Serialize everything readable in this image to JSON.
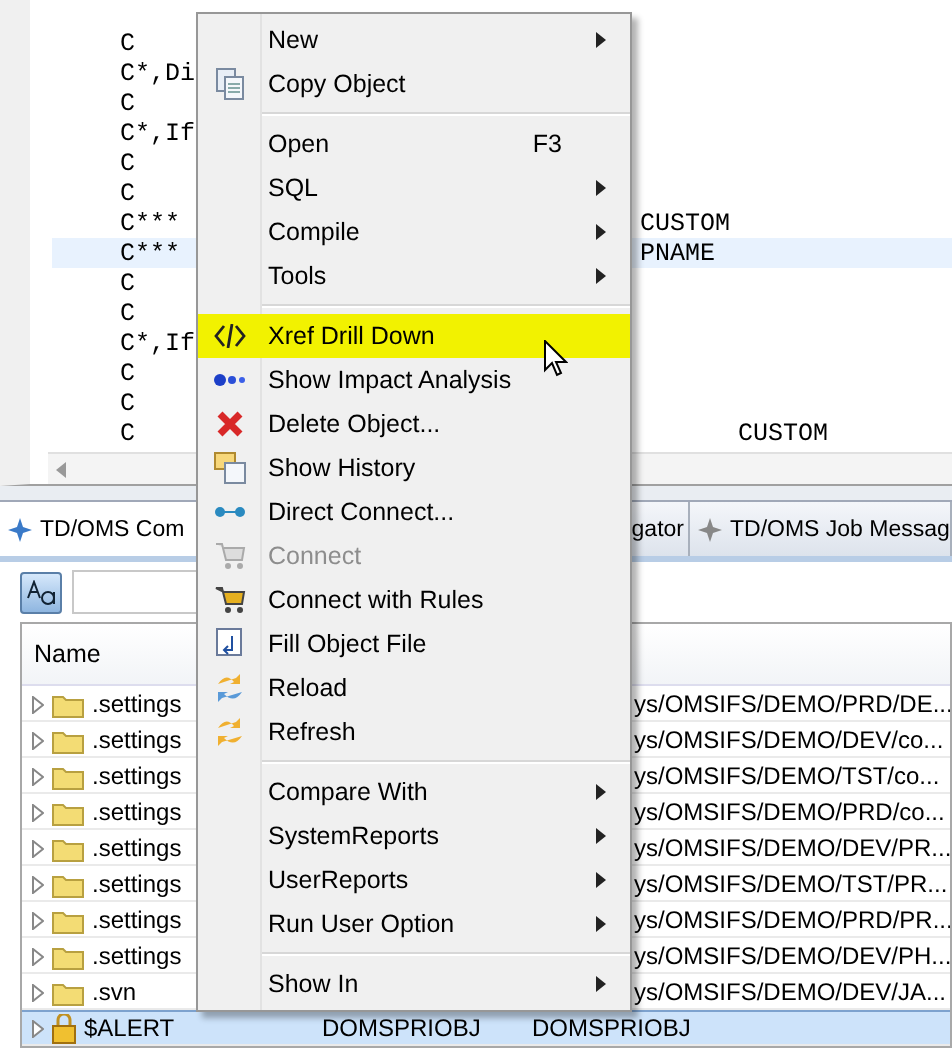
{
  "editor": {
    "lines": [
      {
        "code": "C",
        "selected": false
      },
      {
        "code": "C*,Di",
        "selected": false
      },
      {
        "code": "C",
        "selected": false
      },
      {
        "code": "C*,If",
        "selected": false
      },
      {
        "code": "C",
        "selected": false
      },
      {
        "code": "C",
        "selected": false
      },
      {
        "code": "C***",
        "column_2": "CUSTOM",
        "selected": false
      },
      {
        "code": "C***",
        "column_2": "PNAME",
        "selected": true
      },
      {
        "code": "C",
        "selected": false
      },
      {
        "code": "C",
        "selected": false
      },
      {
        "code": "C*,If",
        "selected": false
      },
      {
        "code": "C",
        "selected": false
      },
      {
        "code": "C",
        "selected": false
      },
      {
        "code": "C",
        "column_3": "CUSTOM",
        "selected": false
      }
    ]
  },
  "view": {
    "tabs": [
      {
        "label": "TD/OMS Com",
        "selected": true
      },
      {
        "label": "gator",
        "selected": false
      },
      {
        "label": "TD/OMS Job Messag",
        "selected": false
      }
    ],
    "table": {
      "columns": [
        "Name"
      ],
      "rows": [
        {
          "name": ".settings",
          "kind": "folder",
          "path": "ys/OMSIFS/DEMO/PRD/DE...",
          "selected": false
        },
        {
          "name": ".settings",
          "kind": "folder",
          "path": "ys/OMSIFS/DEMO/DEV/co...",
          "selected": false
        },
        {
          "name": ".settings",
          "kind": "folder",
          "path": "ys/OMSIFS/DEMO/TST/co...",
          "selected": false
        },
        {
          "name": ".settings",
          "kind": "folder",
          "path": "ys/OMSIFS/DEMO/PRD/co...",
          "selected": false
        },
        {
          "name": ".settings",
          "kind": "folder",
          "path": "ys/OMSIFS/DEMO/DEV/PR...",
          "selected": false
        },
        {
          "name": ".settings",
          "kind": "folder",
          "path": "ys/OMSIFS/DEMO/TST/PR...",
          "selected": false
        },
        {
          "name": ".settings",
          "kind": "folder",
          "path": "ys/OMSIFS/DEMO/PRD/PR...",
          "selected": false
        },
        {
          "name": ".settings",
          "kind": "folder",
          "path": "ys/OMSIFS/DEMO/DEV/PH...",
          "selected": false
        },
        {
          "name": ".svn",
          "kind": "folder",
          "path": "ys/OMSIFS/DEMO/DEV/JA...",
          "selected": false
        },
        {
          "name": "$ALERT",
          "kind": "lock",
          "type": "DOMSPRIOBJ",
          "path": "DOMSPRIOBJ",
          "selected": true
        }
      ]
    }
  },
  "menu": {
    "items": [
      {
        "kind": "item",
        "label": "New",
        "submenu": true,
        "disabled": false,
        "selected": false
      },
      {
        "kind": "item",
        "label": "Copy Object",
        "submenu": false,
        "disabled": false,
        "selected": false
      },
      {
        "kind": "separator"
      },
      {
        "kind": "item",
        "label": "Open",
        "shortcut": "F3",
        "submenu": false,
        "disabled": false,
        "selected": false
      },
      {
        "kind": "item",
        "label": "SQL",
        "submenu": true,
        "disabled": false,
        "selected": false
      },
      {
        "kind": "item",
        "label": "Compile",
        "submenu": true,
        "disabled": false,
        "selected": false
      },
      {
        "kind": "item",
        "label": "Tools",
        "submenu": true,
        "disabled": false,
        "selected": false
      },
      {
        "kind": "separator"
      },
      {
        "kind": "item",
        "label": "Xref Drill Down",
        "submenu": false,
        "disabled": false,
        "selected": true
      },
      {
        "kind": "item",
        "label": "Show Impact Analysis",
        "submenu": false,
        "disabled": false,
        "selected": false
      },
      {
        "kind": "item",
        "label": "Delete Object...",
        "submenu": false,
        "disabled": false,
        "selected": false
      },
      {
        "kind": "item",
        "label": "Show History",
        "submenu": false,
        "disabled": false,
        "selected": false
      },
      {
        "kind": "item",
        "label": "Direct Connect...",
        "submenu": false,
        "disabled": false,
        "selected": false
      },
      {
        "kind": "item",
        "label": "Connect",
        "submenu": false,
        "disabled": true,
        "selected": false
      },
      {
        "kind": "item",
        "label": "Connect with Rules",
        "submenu": false,
        "disabled": false,
        "selected": false
      },
      {
        "kind": "item",
        "label": "Fill Object File",
        "submenu": false,
        "disabled": false,
        "selected": false
      },
      {
        "kind": "item",
        "label": "Reload",
        "submenu": false,
        "disabled": false,
        "selected": false
      },
      {
        "kind": "item",
        "label": "Refresh",
        "submenu": false,
        "disabled": false,
        "selected": false
      },
      {
        "kind": "separator"
      },
      {
        "kind": "item",
        "label": "Compare With",
        "submenu": true,
        "disabled": false,
        "selected": false
      },
      {
        "kind": "item",
        "label": "SystemReports",
        "submenu": true,
        "disabled": false,
        "selected": false
      },
      {
        "kind": "item",
        "label": "UserReports",
        "submenu": true,
        "disabled": false,
        "selected": false
      },
      {
        "kind": "item",
        "label": "Run User Option",
        "submenu": true,
        "disabled": false,
        "selected": false
      },
      {
        "kind": "separator"
      },
      {
        "kind": "item",
        "label": "Show In",
        "submenu": true,
        "disabled": false,
        "selected": false
      }
    ]
  }
}
